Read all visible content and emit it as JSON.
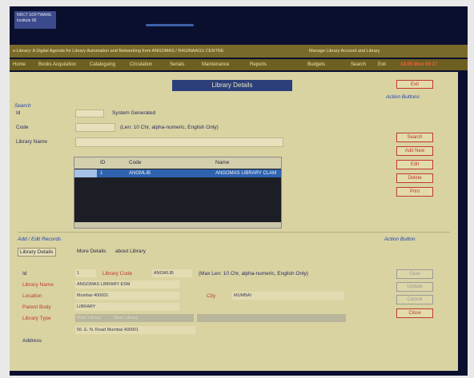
{
  "app": {
    "logo_text": "NRCT SOFTWARE\nInstitute 96",
    "title": "e-Library: A Digital Agenda for Library Automation and Networking from ANGOMAS / RAGINAAGU CENTRE",
    "title_mid": "Manage Library Account and Library",
    "title_right": ""
  },
  "menu": {
    "items": [
      "Home",
      "Books Acquisition",
      "Cataloguing",
      "Circulation",
      "Serials",
      "Maintenance",
      "Reports",
      "Budgets",
      "Search",
      "Exit"
    ],
    "time": "14:05 Mon 09-17"
  },
  "panel": {
    "title": "Library Details"
  },
  "search": {
    "section_label": "Search",
    "id_label": "Id",
    "id_note": "System Generated",
    "code_label": "Code",
    "code_note": "(Len: 10 Chr, alpha-numeric, English Only)",
    "name_label": "Library Name"
  },
  "right_actions_top": {
    "exit": "Exit",
    "heading": "Action Buttons",
    "buttons": [
      "Search",
      "Add New",
      "Edit",
      "Delete",
      "Print"
    ]
  },
  "grid": {
    "columns": [
      "ID",
      "Code",
      "Name"
    ],
    "rows": [
      {
        "id": "1",
        "code": "ANGMLIB",
        "name": "ANGOMAS LIBRARY CLAM"
      }
    ]
  },
  "edit": {
    "section_label": "Add / Edit Records",
    "heading": "Action Button",
    "tabs": [
      "Library Details",
      "More Details",
      "about Library"
    ],
    "id_label": "Id",
    "id_value": "1",
    "code_label": "Library Code",
    "code_value": "ANGMLIB",
    "code_note": "(Max Len: 10 Chr, alpha-numeric, English Only)",
    "name_label": "Library Name",
    "name_value": "ANGOMAS LIBRARY ESM",
    "location_label": "Location",
    "location_value": "Mumbai 400001",
    "city_label": "City",
    "city_value": "MUMBAI",
    "parent_label": "Parent Body",
    "parent_value": "LIBRARY",
    "type_label": "Library Type",
    "type_value": "Main Library",
    "type_extra": "Main Library",
    "address_label": "Address",
    "address_value": "56. E. N. Road Mumbai 400001",
    "buttons": [
      "Save",
      "Update",
      "Cancel",
      "Close"
    ]
  }
}
